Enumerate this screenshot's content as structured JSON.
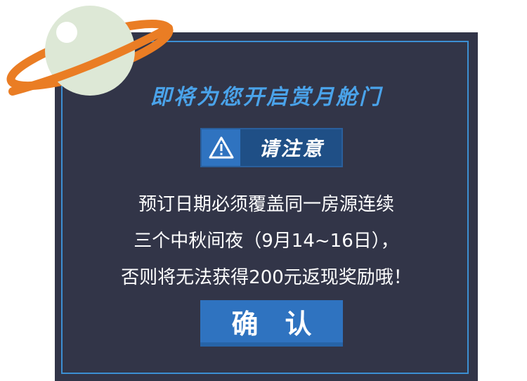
{
  "dialog": {
    "title": "即将为您开启赏月舱门",
    "notice": {
      "icon": "warning-icon",
      "label": "请注意"
    },
    "message_lines": [
      "预订日期必须覆盖同一房源连续",
      "三个中秋间夜（9月14~16日），",
      "否则将无法获得200元返现奖励哦！"
    ],
    "confirm_label": "确　认"
  },
  "colors": {
    "dialog_bg": "#323548",
    "accent_blue": "#2f73c0",
    "title_blue": "#4aa3ea",
    "planet_ring": "#ea7d24",
    "planet_body": "#dde8d6"
  },
  "decoration": {
    "icon": "planet-icon"
  }
}
